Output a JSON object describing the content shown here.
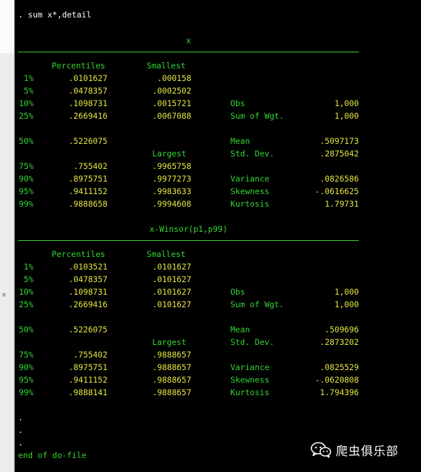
{
  "command": ". sum x*,detail",
  "sections": [
    {
      "title": "x",
      "headers": {
        "percentiles": "Percentiles",
        "smallest": "Smallest",
        "largest": "Largest"
      },
      "rows1": [
        {
          "pct": "1%",
          "value": ".0101627",
          "small": ".000158"
        },
        {
          "pct": "5%",
          "value": ".0478357",
          "small": ".0002502"
        },
        {
          "pct": "10%",
          "value": ".1098731",
          "small": ".0015721",
          "stat": "Obs",
          "stat_value": "1,000"
        },
        {
          "pct": "25%",
          "value": ".2669416",
          "small": ".0067088",
          "stat": "Sum of Wgt.",
          "stat_value": "1,000"
        }
      ],
      "median": {
        "pct": "50%",
        "value": ".5226075",
        "stat": "Mean",
        "stat_value": ".5097173",
        "stat2": "Std. Dev.",
        "stat2_value": ".2875042"
      },
      "rows2": [
        {
          "pct": "75%",
          "value": ".755402",
          "large": ".9965758"
        },
        {
          "pct": "90%",
          "value": ".8975751",
          "large": ".9977273",
          "stat": "Variance",
          "stat_value": ".0826586"
        },
        {
          "pct": "95%",
          "value": ".9411152",
          "large": ".9983633",
          "stat": "Skewness",
          "stat_value": "-.0616625"
        },
        {
          "pct": "99%",
          "value": ".9888658",
          "large": ".9994608",
          "stat": "Kurtosis",
          "stat_value": "1.79731"
        }
      ]
    },
    {
      "title": "x-Winsor(p1,p99)",
      "headers": {
        "percentiles": "Percentiles",
        "smallest": "Smallest",
        "largest": "Largest"
      },
      "rows1": [
        {
          "pct": "1%",
          "value": ".0103521",
          "small": ".0101627"
        },
        {
          "pct": "5%",
          "value": ".0478357",
          "small": ".0101627"
        },
        {
          "pct": "10%",
          "value": ".1098731",
          "small": ".0101627",
          "stat": "Obs",
          "stat_value": "1,000"
        },
        {
          "pct": "25%",
          "value": ".2669416",
          "small": ".0101627",
          "stat": "Sum of Wgt.",
          "stat_value": "1,000"
        }
      ],
      "median": {
        "pct": "50%",
        "value": ".5226075",
        "stat": "Mean",
        "stat_value": ".509696",
        "stat2": "Std. Dev.",
        "stat2_value": ".2873202"
      },
      "rows2": [
        {
          "pct": "75%",
          "value": ".755402",
          "large": ".9888657"
        },
        {
          "pct": "90%",
          "value": ".8975751",
          "large": ".9888657",
          "stat": "Variance",
          "stat_value": ".0825529"
        },
        {
          "pct": "95%",
          "value": ".9411152",
          "large": ".9888657",
          "stat": "Skewness",
          "stat_value": "-.0620808"
        },
        {
          "pct": "99%",
          "value": ".9888141",
          "large": ".9888657",
          "stat": "Kurtosis",
          "stat_value": "1.794396"
        }
      ]
    }
  ],
  "trailer": {
    "dots": [
      ".",
      ".",
      "."
    ],
    "end": "end of do-file"
  },
  "watermark": {
    "text": "爬虫俱乐部",
    "icon": "wechat-icon"
  },
  "colors": {
    "background": "#000000",
    "text": "#ffffff",
    "label": "#33d633",
    "value": "#e6e645"
  }
}
